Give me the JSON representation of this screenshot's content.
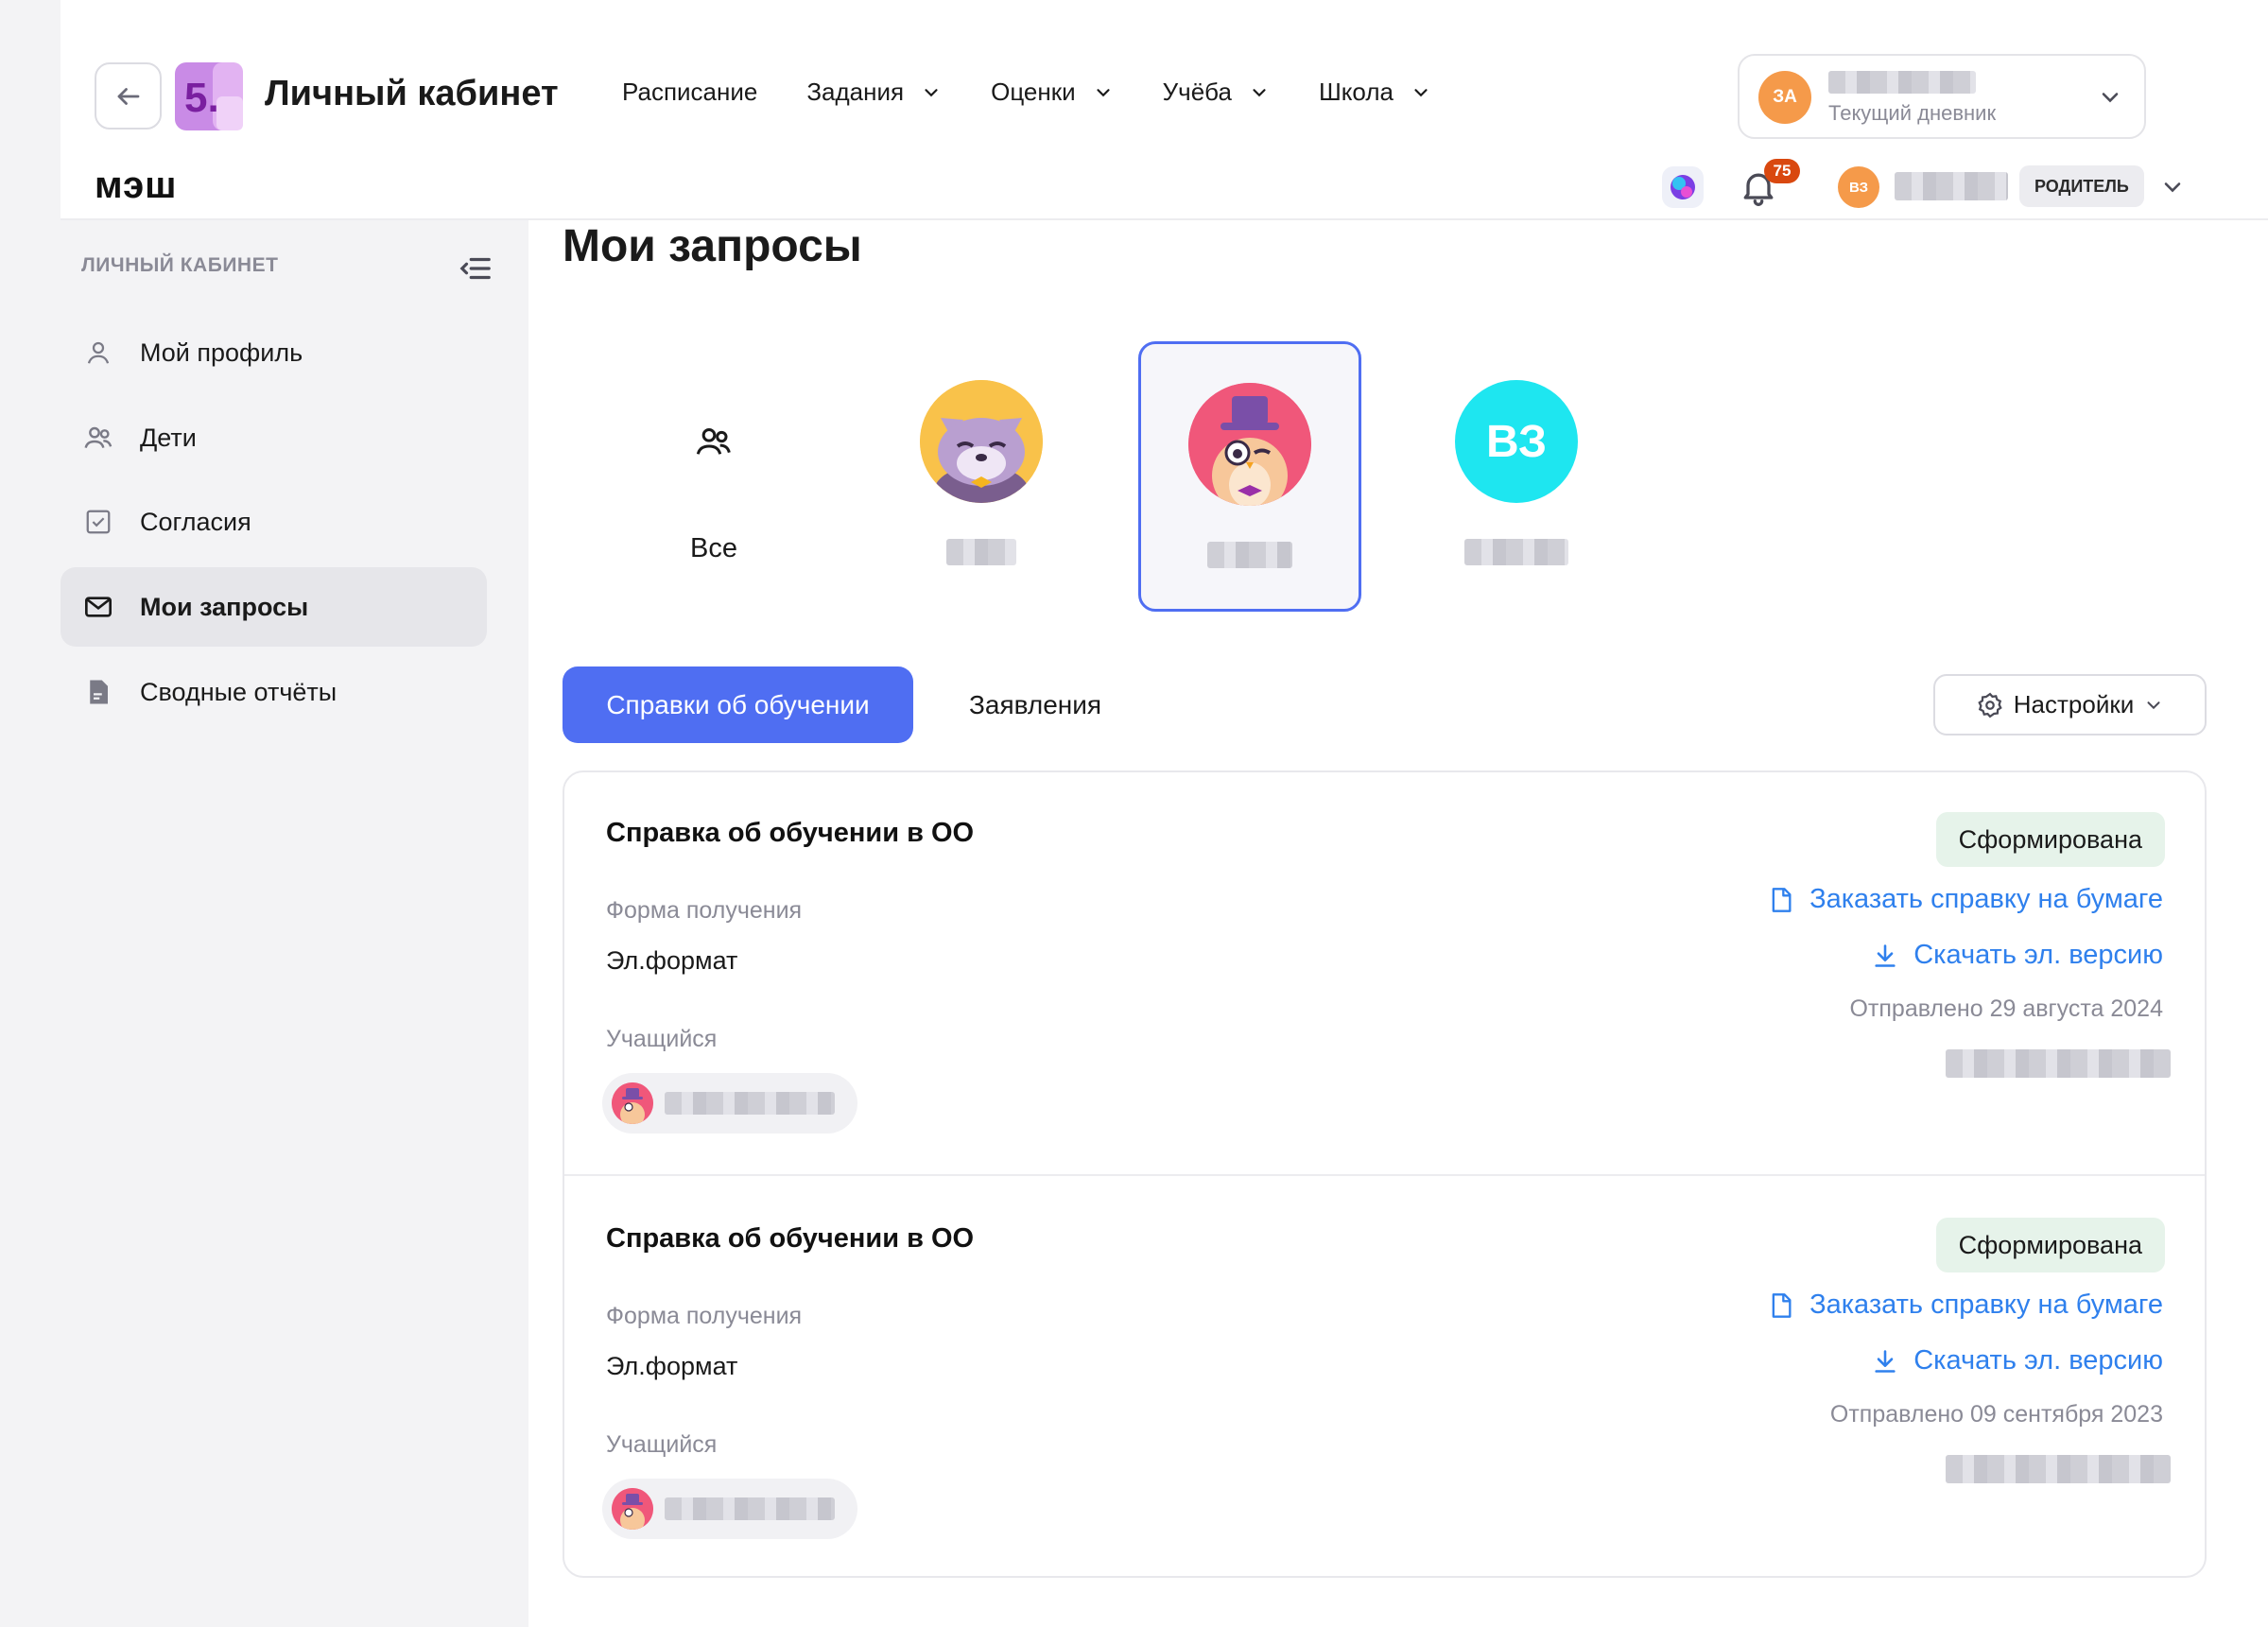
{
  "header": {
    "app_logo_text": "5.",
    "app_title": "Личный кабинет",
    "brand": "мэш",
    "nav": [
      {
        "label": "Расписание",
        "has_dropdown": false
      },
      {
        "label": "Задания",
        "has_dropdown": true
      },
      {
        "label": "Оценки",
        "has_dropdown": true
      },
      {
        "label": "Учёба",
        "has_dropdown": true
      },
      {
        "label": "Школа",
        "has_dropdown": true
      }
    ],
    "diary": {
      "avatar_initials": "ЗА",
      "subtitle": "Текущий дневник"
    },
    "notifications_count": "75",
    "user": {
      "avatar_initials": "ВЗ",
      "role": "РОДИТЕЛЬ"
    }
  },
  "sidebar": {
    "heading": "ЛИЧНЫЙ КАБИНЕТ",
    "items": [
      {
        "label": "Мой профиль",
        "icon": "person-icon",
        "active": false
      },
      {
        "label": "Дети",
        "icon": "people-icon",
        "active": false
      },
      {
        "label": "Согласия",
        "icon": "checkbox-icon",
        "active": false
      },
      {
        "label": "Мои запросы",
        "icon": "envelope-icon",
        "active": true
      },
      {
        "label": "Сводные отчёты",
        "icon": "document-icon",
        "active": false
      }
    ]
  },
  "main": {
    "title": "Мои запросы",
    "children": [
      {
        "label": "Все",
        "type": "all"
      },
      {
        "label": "",
        "type": "cat-avatar"
      },
      {
        "label": "",
        "type": "owl-avatar",
        "selected": true
      },
      {
        "label": "",
        "type": "initials",
        "initials": "ВЗ"
      }
    ],
    "tabs": {
      "active": "Справки об обучении",
      "other": "Заявления"
    },
    "settings_label": "Настройки",
    "requests": [
      {
        "title": "Справка об обучении в ОО",
        "form_label": "Форма получения",
        "form_value": "Эл.формат",
        "student_label": "Учащийся",
        "status": "Сформирована",
        "order_link": "Заказать справку на бумаге",
        "download_link": "Скачать эл. версию",
        "sent": "Отправлено 29 августа 2024"
      },
      {
        "title": "Справка об обучении в ОО",
        "form_label": "Форма получения",
        "form_value": "Эл.формат",
        "student_label": "Учащийся",
        "status": "Сформирована",
        "order_link": "Заказать справку на бумаге",
        "download_link": "Скачать эл. версию",
        "sent": "Отправлено 09 сентября 2023"
      }
    ]
  },
  "colors": {
    "accent": "#4f6ef2",
    "link": "#2f80ed",
    "status_bg": "#e6f3ea",
    "badge": "#d9480f",
    "avatar_orange": "#f59a4a",
    "cyan": "#1ee6f0"
  }
}
